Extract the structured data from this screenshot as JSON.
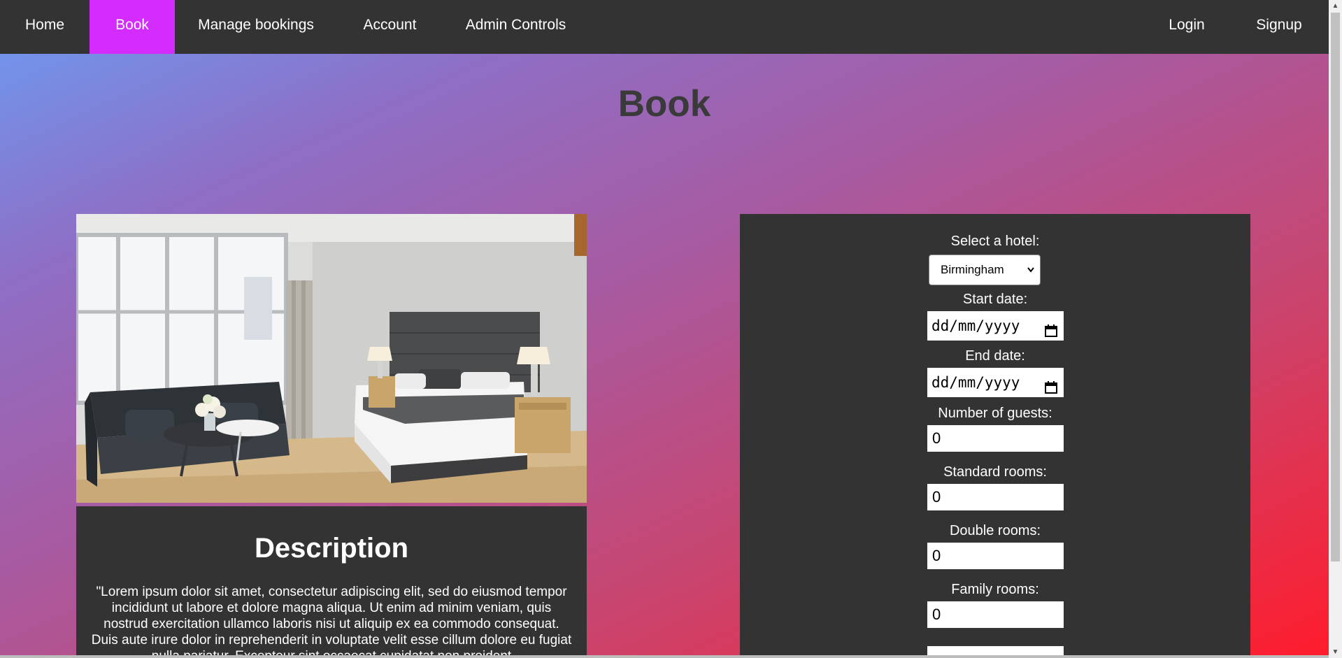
{
  "nav": {
    "home": "Home",
    "book": "Book",
    "manage": "Manage bookings",
    "account": "Account",
    "admin": "Admin Controls",
    "login": "Login",
    "signup": "Signup"
  },
  "page": {
    "title": "Book"
  },
  "description": {
    "title": "Description",
    "text": "\"Lorem ipsum dolor sit amet, consectetur adipiscing elit, sed do eiusmod tempor incididunt ut labore et dolore magna aliqua. Ut enim ad minim veniam, quis nostrud exercitation ullamco laboris nisi ut aliquip ex ea commodo consequat. Duis aute irure dolor in reprehenderit in voluptate velit esse cillum dolore eu fugiat nulla pariatur. Excepteur sint occaecat cupidatat non proident"
  },
  "form": {
    "hotel_label": "Select a hotel:",
    "hotel_value": "Birmingham",
    "start_label": "Start date:",
    "start_value": "dd/mm/yyyy",
    "end_label": "End date:",
    "end_value": "dd/mm/yyyy",
    "guests_label": "Number of guests:",
    "guests_value": "0",
    "standard_label": "Standard rooms:",
    "standard_value": "0",
    "double_label": "Double rooms:",
    "double_value": "0",
    "family_label": "Family rooms:",
    "family_value": "0"
  },
  "colors": {
    "nav_bg": "#333333",
    "nav_active": "#d42bff",
    "panel_bg": "#333333"
  }
}
